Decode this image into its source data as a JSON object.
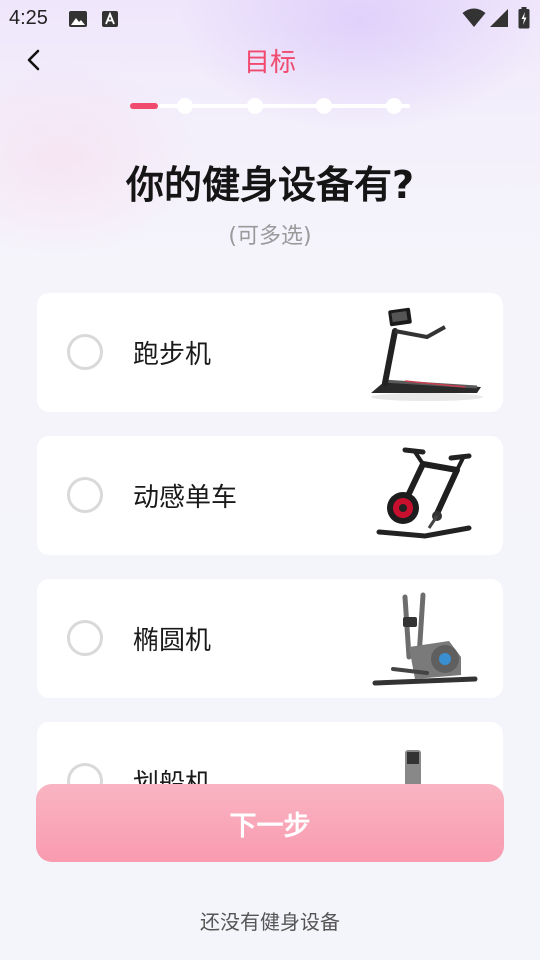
{
  "status_bar": {
    "time": "4:25",
    "icons": [
      "image-icon",
      "text-a-icon",
      "wifi-icon",
      "cell-signal-icon",
      "battery-charging-icon"
    ]
  },
  "header": {
    "title": "目标",
    "back_icon": "chevron-left-icon"
  },
  "progress": {
    "current_step": 1,
    "total_steps": 5,
    "accent": "#f04a6e"
  },
  "question": {
    "title": "你的健身设备有?",
    "hint": "(可多选)"
  },
  "options": [
    {
      "label": "跑步机",
      "image": "treadmill",
      "selected": false
    },
    {
      "label": "动感单车",
      "image": "spin-bike",
      "selected": false
    },
    {
      "label": "椭圆机",
      "image": "elliptical",
      "selected": false
    },
    {
      "label": "划船机",
      "image": "rowing-machine",
      "selected": false
    }
  ],
  "next_button": {
    "label": "下一步",
    "enabled": false
  },
  "no_equipment_link": "还没有健身设备",
  "colors": {
    "accent": "#f04a6e",
    "button": "#f9a8ba",
    "card": "#ffffff"
  }
}
